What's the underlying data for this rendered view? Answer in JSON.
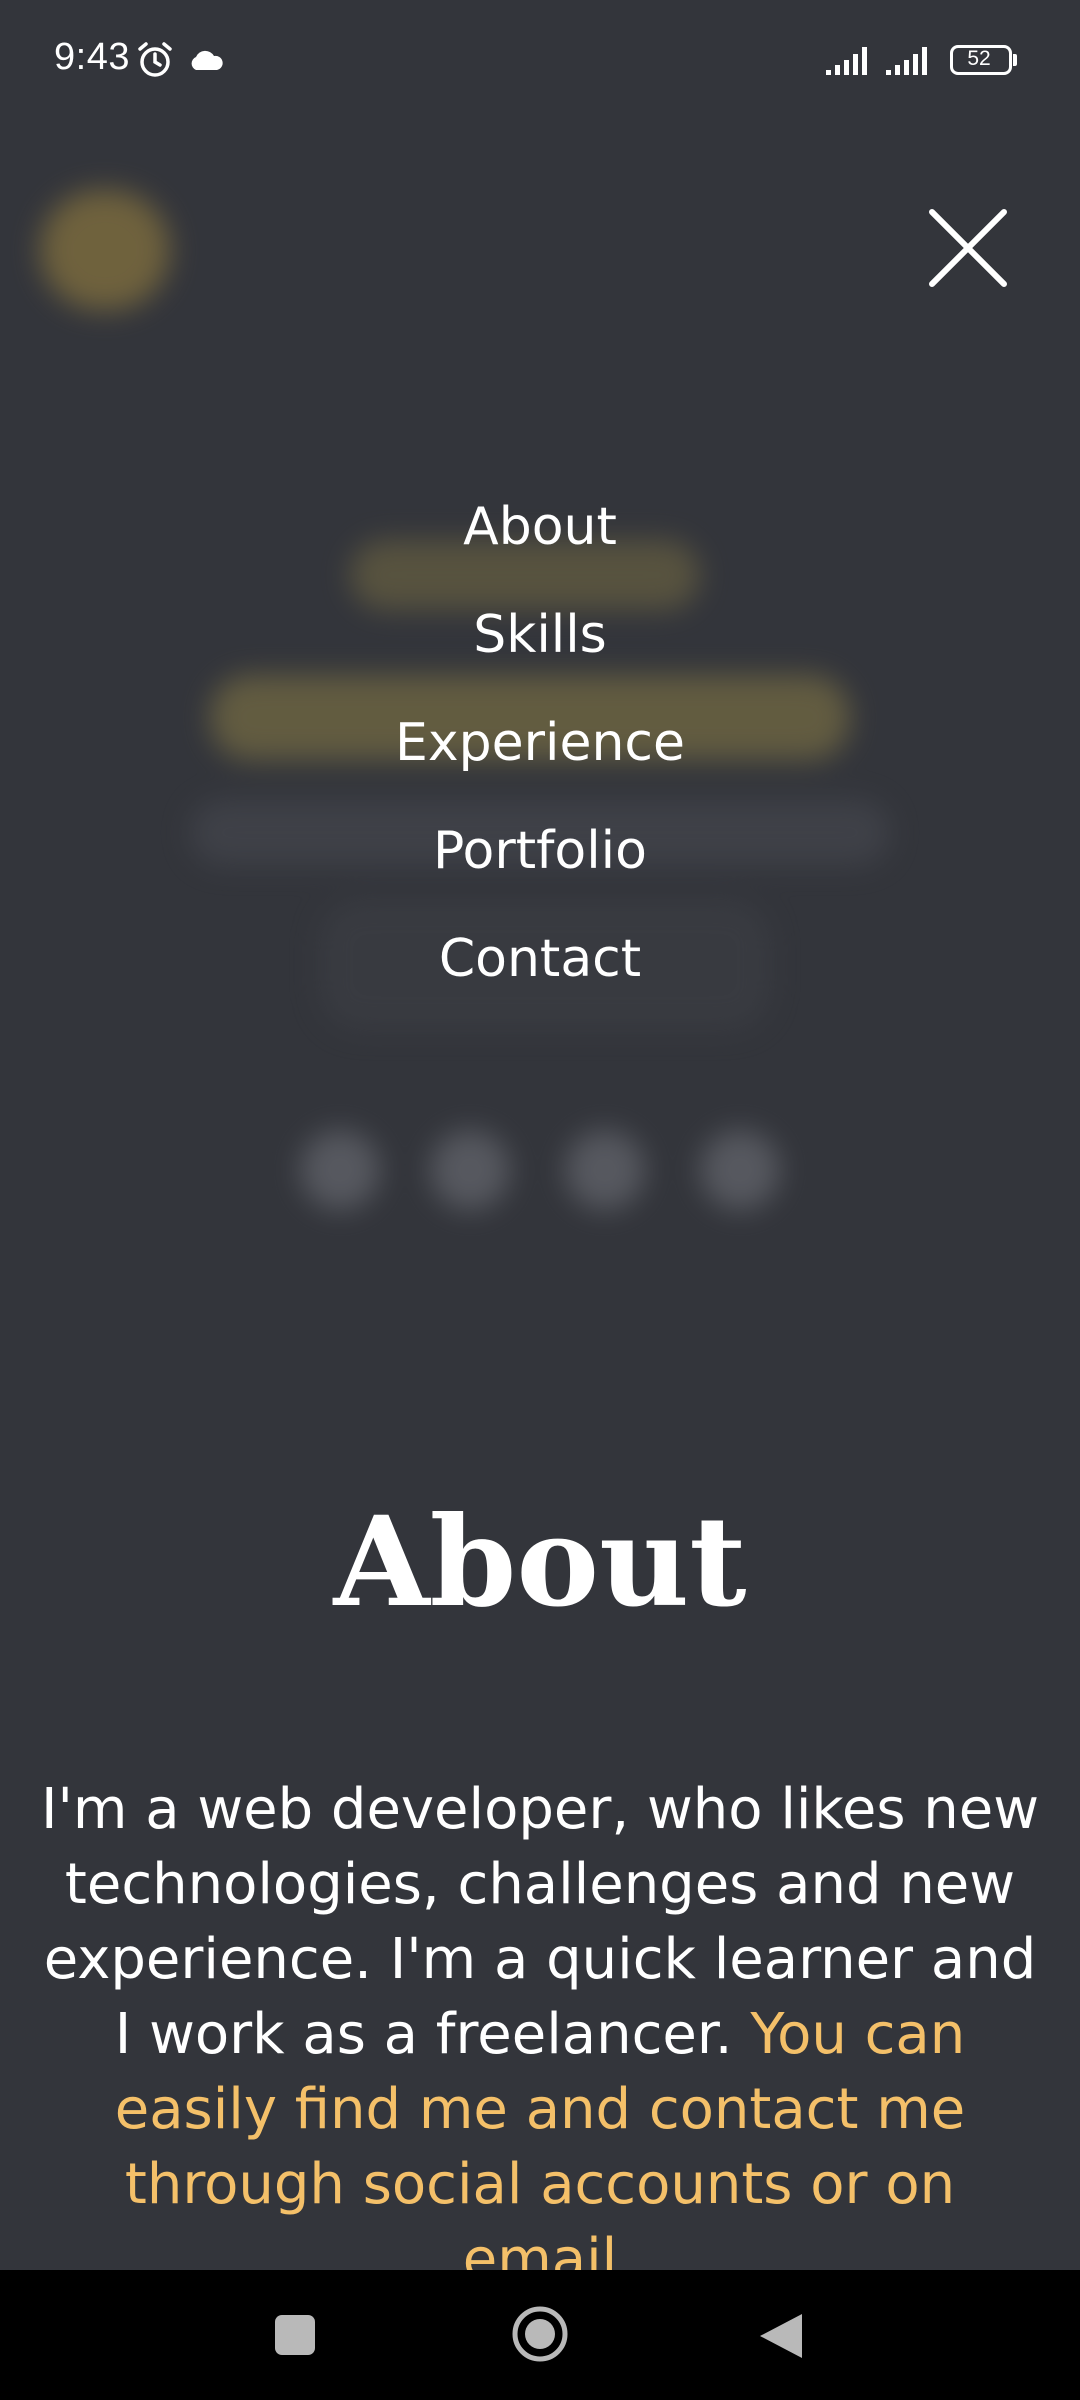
{
  "status_bar": {
    "time": "9:43",
    "battery_level": "52",
    "icons": [
      "alarm-icon",
      "cloud-icon",
      "signal-icon",
      "signal-icon",
      "battery-icon"
    ]
  },
  "menu": {
    "close_icon": "close-icon",
    "items": [
      {
        "label": "About"
      },
      {
        "label": "Skills"
      },
      {
        "label": "Experience"
      },
      {
        "label": "Portfolio"
      },
      {
        "label": "Contact"
      }
    ]
  },
  "about": {
    "title": "About",
    "text_plain": "I'm a web developer, who likes new technologies, challenges and new experience. I'm a quick learner and I work as a freelancer. ",
    "text_highlight": "You can easily find me and contact me through social accounts or on email"
  },
  "nav_bar": {
    "icons": [
      "recents-icon",
      "home-icon",
      "back-icon"
    ]
  },
  "colors": {
    "background": "#33353b",
    "accent": "#f4c069",
    "text": "#ffffff",
    "nav_bar": "#000000"
  }
}
